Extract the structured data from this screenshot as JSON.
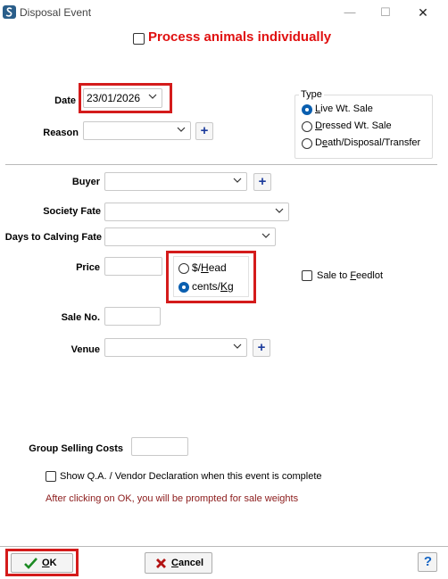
{
  "window": {
    "title": "Disposal Event",
    "controls": {
      "minimize": "—",
      "maximize": "☐",
      "close": "✕"
    }
  },
  "header": {
    "process_individually_label": "Process animals individually",
    "process_individually_checked": false,
    "accent_color": "#e01010"
  },
  "date": {
    "label": "Date",
    "value": "23/01/2026"
  },
  "reason": {
    "label": "Reason",
    "value": ""
  },
  "type_group": {
    "title": "Type",
    "options": [
      {
        "pre": "",
        "ul": "L",
        "post": "ive Wt. Sale",
        "selected": true
      },
      {
        "pre": "",
        "ul": "D",
        "post": "ressed Wt. Sale",
        "selected": false
      },
      {
        "pre": "D",
        "ul": "e",
        "post": "ath/Disposal/Transfer",
        "selected": false
      }
    ]
  },
  "buyer": {
    "label": "Buyer",
    "value": ""
  },
  "society_fate": {
    "label": "Society Fate",
    "value": ""
  },
  "days_to_calving_fate": {
    "label": "Days to Calving Fate",
    "value": ""
  },
  "price": {
    "label": "Price",
    "value": "",
    "unit_options": [
      {
        "pre": "$/",
        "ul": "H",
        "post": "ead",
        "selected": false
      },
      {
        "pre": "cents/",
        "ul": "K",
        "post": "g",
        "selected": true
      }
    ]
  },
  "sale_to_feedlot": {
    "pre": "Sale to ",
    "ul": "F",
    "post": "eedlot",
    "checked": false
  },
  "sale_no": {
    "label": "Sale No.",
    "value": ""
  },
  "venue": {
    "label": "Venue",
    "value": ""
  },
  "group_selling_costs": {
    "label": "Group Selling Costs",
    "value": ""
  },
  "show_qa": {
    "label": "Show Q.A. / Vendor Declaration when this event is complete",
    "checked": false
  },
  "notice": {
    "text": "After clicking on OK, you will be prompted for sale weights",
    "color": "#8b1a1a"
  },
  "footer": {
    "ok": {
      "ul": "O",
      "post": "K"
    },
    "cancel": {
      "ul": "C",
      "post": "ancel"
    },
    "help": "?"
  },
  "icons": {
    "plus": "+",
    "ok_icon": "check-icon",
    "cancel_icon": "x-icon",
    "help_icon": "help-icon"
  }
}
